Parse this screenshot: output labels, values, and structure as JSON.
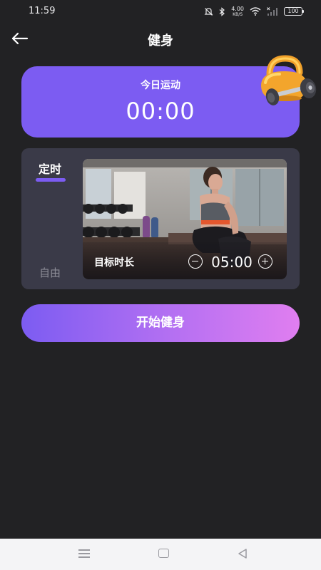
{
  "status_bar": {
    "time": "11:59",
    "net_speed_value": "4.00",
    "net_speed_unit": "KB/S",
    "battery": "100"
  },
  "header": {
    "title": "健身",
    "back_icon": "arrow-left-icon"
  },
  "today_card": {
    "label": "今日运动",
    "timer": "00:00",
    "icon": "kettlebell-dumbbell-icon"
  },
  "mode_panel": {
    "tabs": [
      {
        "label": "定时",
        "selected": true
      },
      {
        "label": "自由",
        "selected": false
      }
    ],
    "target_label": "目标时长",
    "duration": "05:00"
  },
  "start_button": {
    "label": "开始健身"
  },
  "nav_bar": {
    "icons": [
      "menu-icon",
      "home-icon",
      "back-triangle-icon"
    ]
  },
  "colors": {
    "background": "#222224",
    "accent": "#7c5cf2",
    "panel": "#3a3a48",
    "gradient_end": "#e07ef0"
  }
}
